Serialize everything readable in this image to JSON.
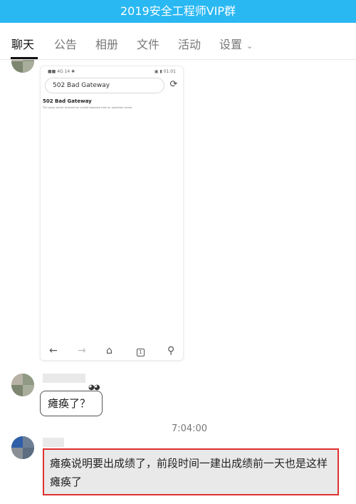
{
  "window": {
    "title": "2019安全工程师VIP群"
  },
  "tabs": [
    {
      "label": "聊天"
    },
    {
      "label": "公告"
    },
    {
      "label": "相册"
    },
    {
      "label": "文件"
    },
    {
      "label": "活动"
    },
    {
      "label": "设置"
    }
  ],
  "messages": {
    "image_message": {
      "status_left": "■■ 4G 14 ✱",
      "status_right": "▣ ▮ 01:01",
      "url": "502 Bad Gateway",
      "error_title": "502 Bad Gateway",
      "error_description": "The proxy server received an invalid response from an upstream server."
    },
    "bubble1": {
      "text": "瘫痪了？"
    },
    "timestamp": "7:04:00",
    "bubble2": {
      "text": "瘫痪说明要出成绩了，前段时间一建出成绩前一天也是这样瘫痪了"
    }
  },
  "colors": {
    "titlebar": "#29b8f2",
    "highlight_border": "#e03030"
  }
}
